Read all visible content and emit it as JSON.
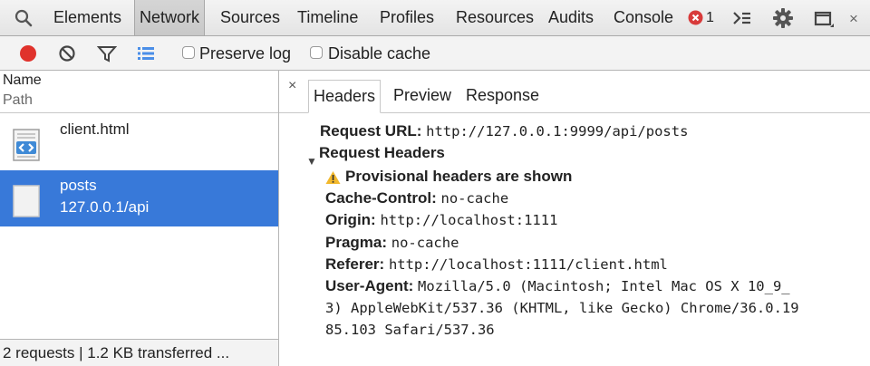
{
  "top_tabs": [
    "Elements",
    "Network",
    "Sources",
    "Timeline",
    "Profiles",
    "Resources",
    "Audits",
    "Console"
  ],
  "selected_tab": "Network",
  "error_count": "1",
  "close_label": "×",
  "toolbar": {
    "preserve_log_label": "Preserve log",
    "disable_cache_label": "Disable cache",
    "record_color": "#e0322c",
    "filter_icon_color": "#4a8ee8"
  },
  "columns": {
    "name": "Name",
    "path": "Path"
  },
  "requests": [
    {
      "name": "client.html",
      "path": ""
    },
    {
      "name": "posts",
      "path": "127.0.0.1/api"
    }
  ],
  "status_text": "2 requests | 1.2 KB transferred ...",
  "detail_close": "×",
  "detail_tabs": [
    "Headers",
    "Preview",
    "Response"
  ],
  "detail": {
    "request_url_label": "Request URL:",
    "request_url": "http://127.0.0.1:9999/api/posts",
    "request_headers_label": "Request Headers",
    "provisional_warning": "Provisional headers are shown",
    "headers": [
      {
        "key": "Cache-Control:",
        "value": "no-cache"
      },
      {
        "key": "Origin:",
        "value": "http://localhost:1111"
      },
      {
        "key": "Pragma:",
        "value": "no-cache"
      },
      {
        "key": "Referer:",
        "value": "http://localhost:1111/client.html"
      },
      {
        "key": "User-Agent:",
        "value": "Mozilla/5.0 (Macintosh; Intel Mac OS X 10_9_"
      }
    ],
    "user_agent_cont": [
      "3) AppleWebKit/537.36 (KHTML, like Gecko) Chrome/36.0.19",
      "85.103 Safari/537.36"
    ]
  },
  "accent_color": "#3879d9"
}
